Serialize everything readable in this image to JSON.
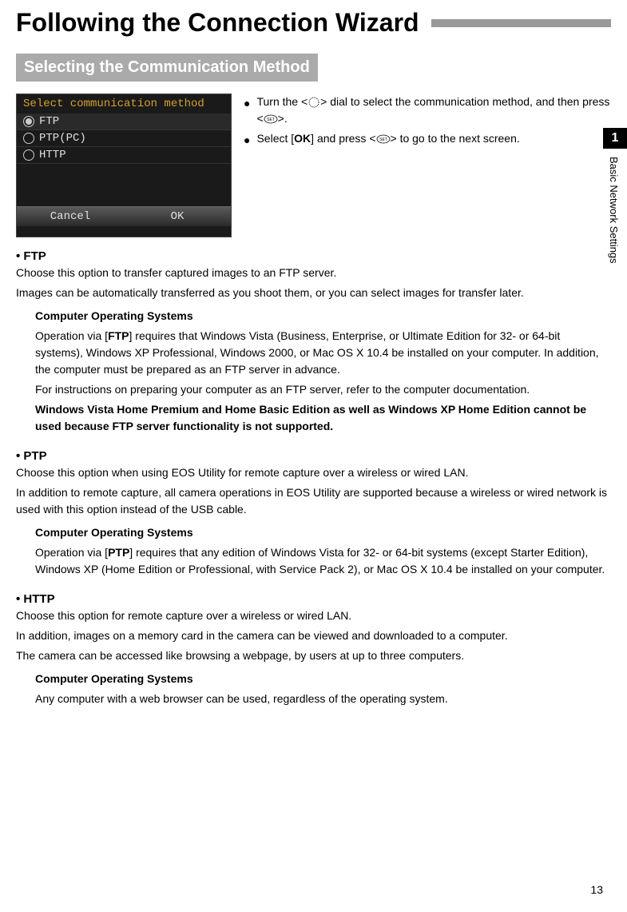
{
  "title": "Following the Connection Wizard",
  "section_header": "Selecting the Communication Method",
  "camera": {
    "header": "Select communication method",
    "items": [
      "FTP",
      "PTP(PC)",
      "HTTP"
    ],
    "cancel": "Cancel",
    "ok": "OK"
  },
  "instructions": {
    "line1a": "Turn the <",
    "line1b": "> dial to select the communication method, and then press <",
    "line1c": ">.",
    "line2a": "Select [",
    "line2b": "OK",
    "line2c": "] and press <",
    "line2d": "> to go to the next screen."
  },
  "ftp": {
    "title": "• FTP",
    "desc1": "Choose this option to transfer captured images to an FTP server.",
    "desc2": "Images can be automatically transferred as you shoot them, or you can select images for transfer later.",
    "cos_title": "Computer Operating Systems",
    "cos1a": "Operation via [",
    "cos1b": "FTP",
    "cos1c": "] requires that Windows Vista (Business, Enterprise, or Ultimate Edition for 32- or 64-bit systems), Windows XP Professional, Windows 2000, or Mac OS X 10.4 be installed on your computer. In addition, the computer must be prepared as an FTP server in advance.",
    "cos2": "For instructions on preparing your computer as an FTP server, refer to the computer documentation.",
    "cos3": "Windows Vista Home Premium and Home Basic Edition as well as Windows XP Home Edition cannot be used because FTP server functionality is not supported."
  },
  "ptp": {
    "title": "• PTP",
    "desc1": "Choose this option when using EOS Utility for remote capture over a wireless or wired LAN.",
    "desc2": "In addition to remote capture, all camera operations in EOS Utility are supported because a wireless or wired network is used with this option instead of the USB cable.",
    "cos_title": "Computer Operating Systems",
    "cos1a": "Operation via [",
    "cos1b": "PTP",
    "cos1c": "] requires that any edition of Windows Vista for 32- or 64-bit systems (except Starter Edition), Windows XP (Home Edition or Professional, with Service Pack 2), or Mac OS X 10.4 be installed on your computer."
  },
  "http": {
    "title": "• HTTP",
    "desc1": "Choose this option for remote capture over a wireless or wired LAN.",
    "desc2": "In addition, images on a memory card in the camera can be viewed and downloaded to a computer.",
    "desc3": "The camera can be accessed like browsing a webpage, by users at up to three computers.",
    "cos_title": "Computer Operating Systems",
    "cos1": "Any computer with a web browser can be used, regardless of the operating system."
  },
  "tab": {
    "number": "1",
    "text": "Basic Network Settings"
  },
  "page": "13"
}
